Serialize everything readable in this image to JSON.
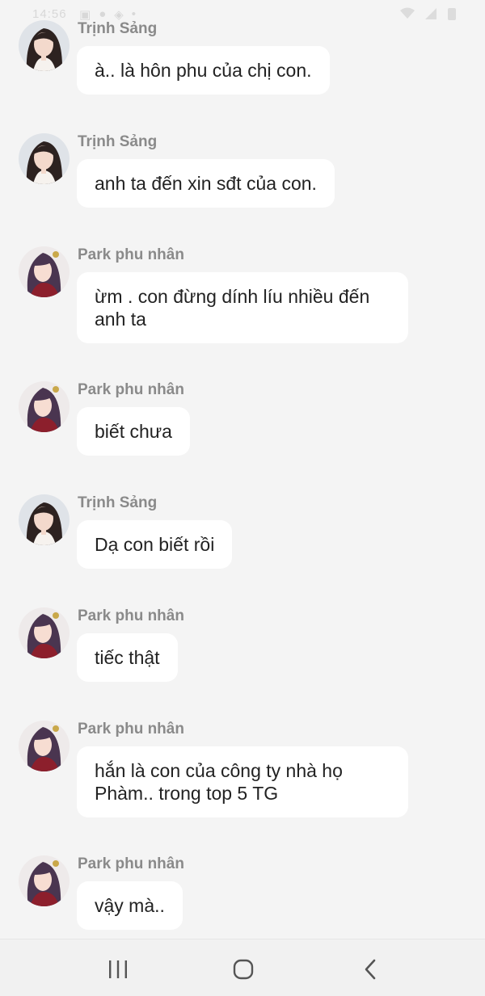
{
  "status_bar": {
    "time": "14:56"
  },
  "messages": [
    {
      "sender": "Trịnh Sảng",
      "avatar": "girl-avatar",
      "text": "à.. là hôn phu của chị con."
    },
    {
      "sender": "Trịnh Sảng",
      "avatar": "girl-avatar",
      "text": "anh ta đến xin sđt của con."
    },
    {
      "sender": "Park phu nhân",
      "avatar": "lady-avatar",
      "text": "ừm . con đừng dính líu nhiều đến anh ta"
    },
    {
      "sender": "Park phu nhân",
      "avatar": "lady-avatar",
      "text": "biết chưa"
    },
    {
      "sender": "Trịnh Sảng",
      "avatar": "girl-avatar",
      "text": "Dạ con biết rồi"
    },
    {
      "sender": "Park phu nhân",
      "avatar": "lady-avatar",
      "text": "tiếc thật"
    },
    {
      "sender": "Park phu nhân",
      "avatar": "lady-avatar",
      "text": "hắn là con của công ty nhà họ Phàm.. trong top 5 TG"
    },
    {
      "sender": "Park phu nhân",
      "avatar": "lady-avatar",
      "text": "vậy mà.."
    }
  ],
  "nav_bar": {
    "recents": "recents-icon",
    "home": "home-icon",
    "back": "back-icon"
  }
}
